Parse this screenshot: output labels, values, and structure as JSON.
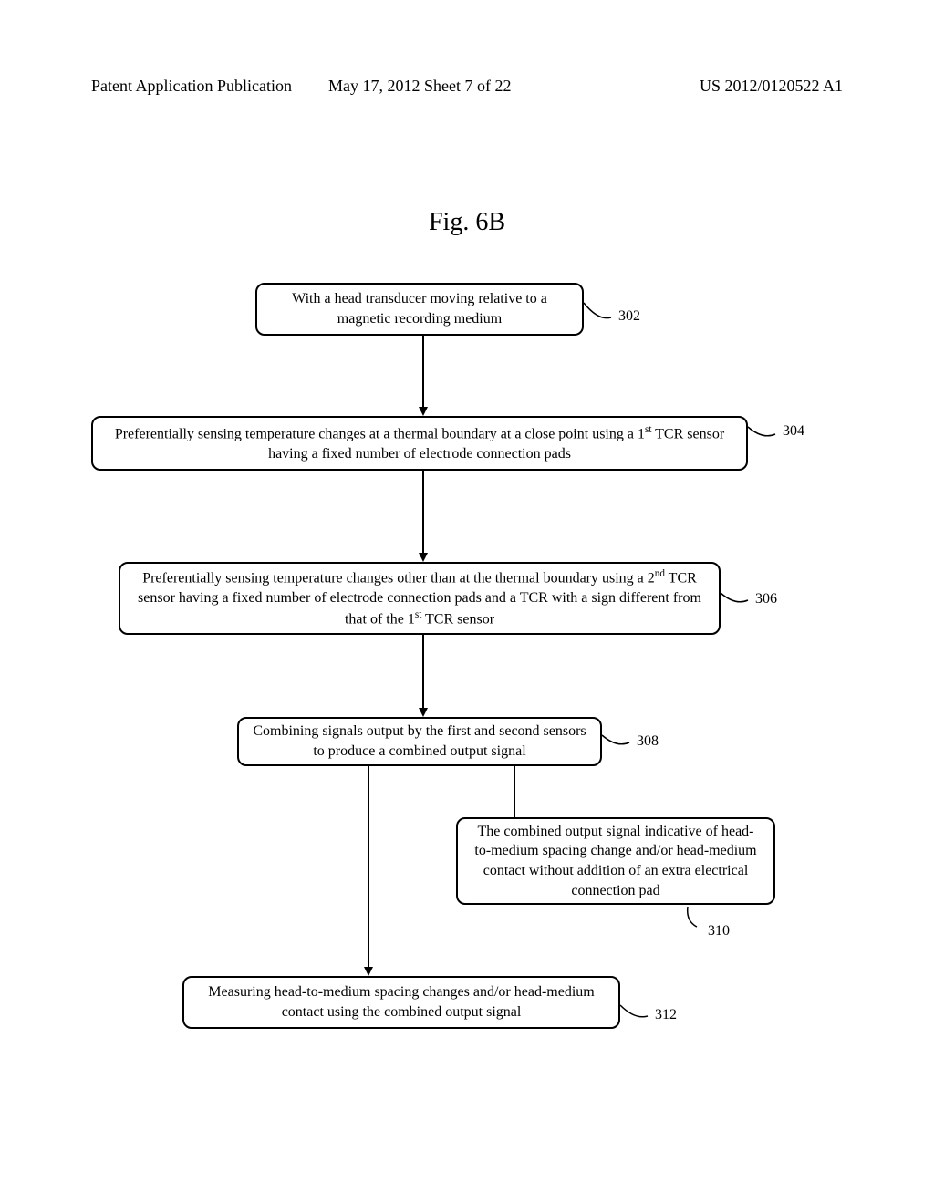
{
  "header": {
    "left": "Patent Application Publication",
    "mid": "May 17, 2012  Sheet 7 of 22",
    "right": "US 2012/0120522 A1"
  },
  "figure_title": "Fig. 6B",
  "boxes": {
    "b302": {
      "text": "With a head transducer moving relative to a magnetic recording medium",
      "ref": "302"
    },
    "b304": {
      "text_pre": "Preferentially sensing temperature changes at a thermal boundary at a close point using a 1",
      "text_sup": "st",
      "text_post": " TCR sensor having a fixed number of electrode connection pads",
      "ref": "304"
    },
    "b306": {
      "text_line1_pre": "Preferentially sensing temperature changes other than at the thermal boundary using a 2",
      "text_line1_sup": "nd",
      "text_line1_post": " TCR sensor having a fixed number of electrode connection pads and a TCR with a sign different from that of the 1",
      "text_line1_sup2": "st",
      "text_line1_post2": " TCR sensor",
      "ref": "306"
    },
    "b308": {
      "text": "Combining signals output by the first and second sensors to produce a combined output signal",
      "ref": "308"
    },
    "b310": {
      "text": "The combined output signal indicative of head-to-medium spacing change and/or head-medium contact without addition of an extra electrical connection pad",
      "ref": "310"
    },
    "b312": {
      "text": "Measuring head-to-medium spacing changes and/or head-medium contact using the combined output signal",
      "ref": "312"
    }
  }
}
